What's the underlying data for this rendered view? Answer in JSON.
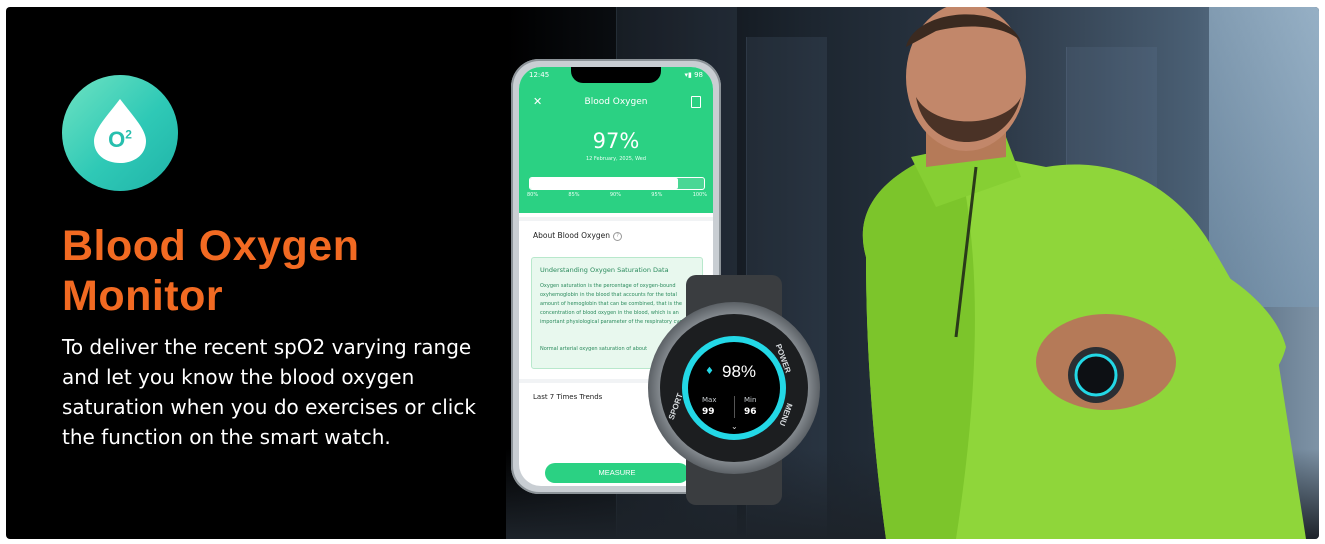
{
  "colors": {
    "accent_orange": "#f26a22",
    "app_green": "#2bd183",
    "watch_cyan": "#23d8e6",
    "logo_teal": "#2fc9b6"
  },
  "logo": {
    "icon": "oxygen-drop-icon",
    "letter": "O",
    "sup": "2"
  },
  "headline": {
    "title": "Blood Oxygen Monitor",
    "description": "To deliver the recent spO2 varying range and let you know the blood oxygen saturation when you do exercises or click the function on the smart watch."
  },
  "phone": {
    "status_time": "12:45",
    "status_right": "▾▮ 98",
    "title": "Blood Oxygen",
    "value": "97%",
    "date": "12 February, 2025, Wed",
    "progress": 0.85,
    "scale": [
      "80%",
      "85%",
      "90%",
      "95%",
      "100%"
    ],
    "about_label": "About Blood Oxygen",
    "info_heading": "Understanding Oxygen Saturation Data",
    "info_text": "Oxygen saturation is the percentage of oxygen-bound oxyhemoglobin in the blood that accounts for the total amount of hemoglobin that can be combined, that is the concentration of blood oxygen in the blood, which is an important physiological parameter of the respiratory cycle.",
    "info_text2": "Normal arterial oxygen saturation of about",
    "trends_label": "Last 7 Times Trends",
    "measure_label": "MEASURE"
  },
  "watch": {
    "value": "98%",
    "max_label": "Max",
    "max_value": "99",
    "min_label": "Min",
    "min_value": "96",
    "bezel_left": "SPORT",
    "bezel_right_top": "POWER",
    "bezel_right_bottom": "MENU"
  }
}
